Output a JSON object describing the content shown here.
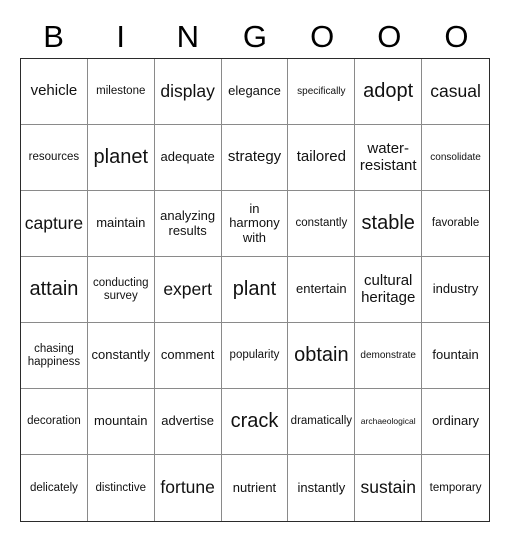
{
  "card": {
    "title_letters": [
      "B",
      "I",
      "N",
      "G",
      "O",
      "O",
      "O"
    ],
    "columns": 7,
    "rows": 7,
    "border_color": "#2b2b2b",
    "grid_line_color": "#8a8a8a",
    "background_color": "#ffffff",
    "text_color": "#111111",
    "cells": [
      [
        {
          "text": "vehicle",
          "size": "l"
        },
        {
          "text": "milestone",
          "size": "m"
        },
        {
          "text": "display",
          "size": "xl"
        },
        {
          "text": "elegance",
          "size": "ml"
        },
        {
          "text": "specifically",
          "size": "s"
        },
        {
          "text": "adopt",
          "size": "xxl"
        },
        {
          "text": "casual",
          "size": "xl"
        }
      ],
      [
        {
          "text": "resources",
          "size": "m"
        },
        {
          "text": "planet",
          "size": "xxl"
        },
        {
          "text": "adequate",
          "size": "ml"
        },
        {
          "text": "strategy",
          "size": "l"
        },
        {
          "text": "tailored",
          "size": "l"
        },
        {
          "text": "water-resistant",
          "size": "l"
        },
        {
          "text": "consolidate",
          "size": "s"
        }
      ],
      [
        {
          "text": "capture",
          "size": "xl"
        },
        {
          "text": "maintain",
          "size": "ml"
        },
        {
          "text": "analyzing results",
          "size": "ml"
        },
        {
          "text": "in harmony with",
          "size": "ml"
        },
        {
          "text": "constantly",
          "size": "m"
        },
        {
          "text": "stable",
          "size": "xxl"
        },
        {
          "text": "favorable",
          "size": "m"
        }
      ],
      [
        {
          "text": "attain",
          "size": "xxl"
        },
        {
          "text": "conducting survey",
          "size": "m"
        },
        {
          "text": "expert",
          "size": "xl"
        },
        {
          "text": "plant",
          "size": "xxl"
        },
        {
          "text": "entertain",
          "size": "ml"
        },
        {
          "text": "cultural heritage",
          "size": "l"
        },
        {
          "text": "industry",
          "size": "ml"
        }
      ],
      [
        {
          "text": "chasing happiness",
          "size": "m"
        },
        {
          "text": "constantly",
          "size": "ml"
        },
        {
          "text": "comment",
          "size": "ml"
        },
        {
          "text": "popularity",
          "size": "m"
        },
        {
          "text": "obtain",
          "size": "xxl"
        },
        {
          "text": "demonstrate",
          "size": "s"
        },
        {
          "text": "fountain",
          "size": "ml"
        }
      ],
      [
        {
          "text": "decoration",
          "size": "m"
        },
        {
          "text": "mountain",
          "size": "ml"
        },
        {
          "text": "advertise",
          "size": "ml"
        },
        {
          "text": "crack",
          "size": "xxl"
        },
        {
          "text": "dramatically",
          "size": "m"
        },
        {
          "text": "archaeological",
          "size": "xs"
        },
        {
          "text": "ordinary",
          "size": "ml"
        }
      ],
      [
        {
          "text": "delicately",
          "size": "m"
        },
        {
          "text": "distinctive",
          "size": "m"
        },
        {
          "text": "fortune",
          "size": "xl"
        },
        {
          "text": "nutrient",
          "size": "ml"
        },
        {
          "text": "instantly",
          "size": "ml"
        },
        {
          "text": "sustain",
          "size": "xl"
        },
        {
          "text": "temporary",
          "size": "m"
        }
      ]
    ]
  }
}
